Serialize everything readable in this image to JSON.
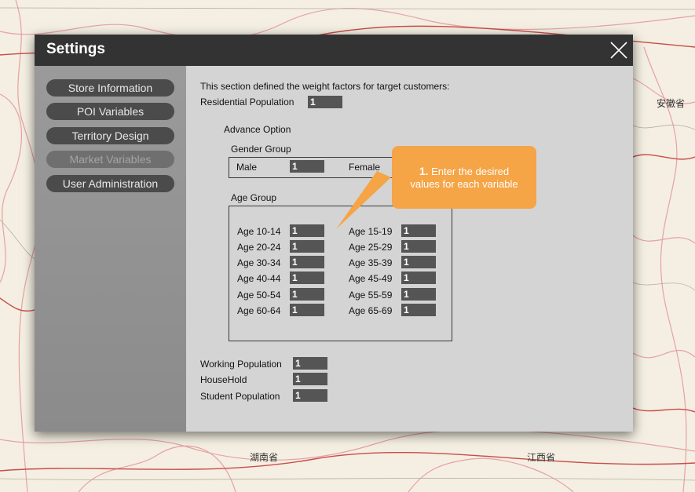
{
  "map": {
    "labels": [
      "安徽省",
      "湖南省",
      "江西省"
    ]
  },
  "dialog": {
    "title": "Settings",
    "close_icon": "close-icon"
  },
  "sidebar": {
    "items": [
      {
        "label": "Store Information",
        "disabled": false
      },
      {
        "label": "POI Variables",
        "disabled": false
      },
      {
        "label": "Territory Design",
        "disabled": false
      },
      {
        "label": "Market Variables",
        "disabled": true
      },
      {
        "label": "User Administration",
        "disabled": false
      }
    ]
  },
  "content": {
    "intro": "This section defined the weight factors for target customers:",
    "residential_label": "Residential Population",
    "residential_value": "1",
    "advance_option": "Advance Option",
    "gender_group": {
      "title": "Gender Group",
      "male_label": "Male",
      "male_value": "1",
      "female_label": "Female"
    },
    "age_group": {
      "title": "Age Group",
      "left": [
        {
          "label": "Age 10-14",
          "value": "1"
        },
        {
          "label": "Age 20-24",
          "value": "1"
        },
        {
          "label": "Age 30-34",
          "value": "1"
        },
        {
          "label": "Age 40-44",
          "value": "1"
        },
        {
          "label": "Age 50-54",
          "value": "1"
        },
        {
          "label": "Age 60-64",
          "value": "1"
        }
      ],
      "right": [
        {
          "label": "Age 15-19",
          "value": "1"
        },
        {
          "label": "Age 25-29",
          "value": "1"
        },
        {
          "label": "Age 35-39",
          "value": "1"
        },
        {
          "label": "Age 45-49",
          "value": "1"
        },
        {
          "label": "Age 55-59",
          "value": "1"
        },
        {
          "label": "Age 65-69",
          "value": "1"
        }
      ]
    },
    "working_label": "Working Population",
    "working_value": "1",
    "household_label": "HouseHold",
    "household_value": "1",
    "student_label": "Student Population",
    "student_value": "1"
  },
  "callout": {
    "number": "1.",
    "line1": "Enter the desired",
    "line2": "values for each variable"
  },
  "colors": {
    "titlebar": "#333333",
    "panel": "#d4d4d4",
    "sidebar": "#8b8b8b",
    "callout": "#f5a446",
    "field": "#555555"
  }
}
